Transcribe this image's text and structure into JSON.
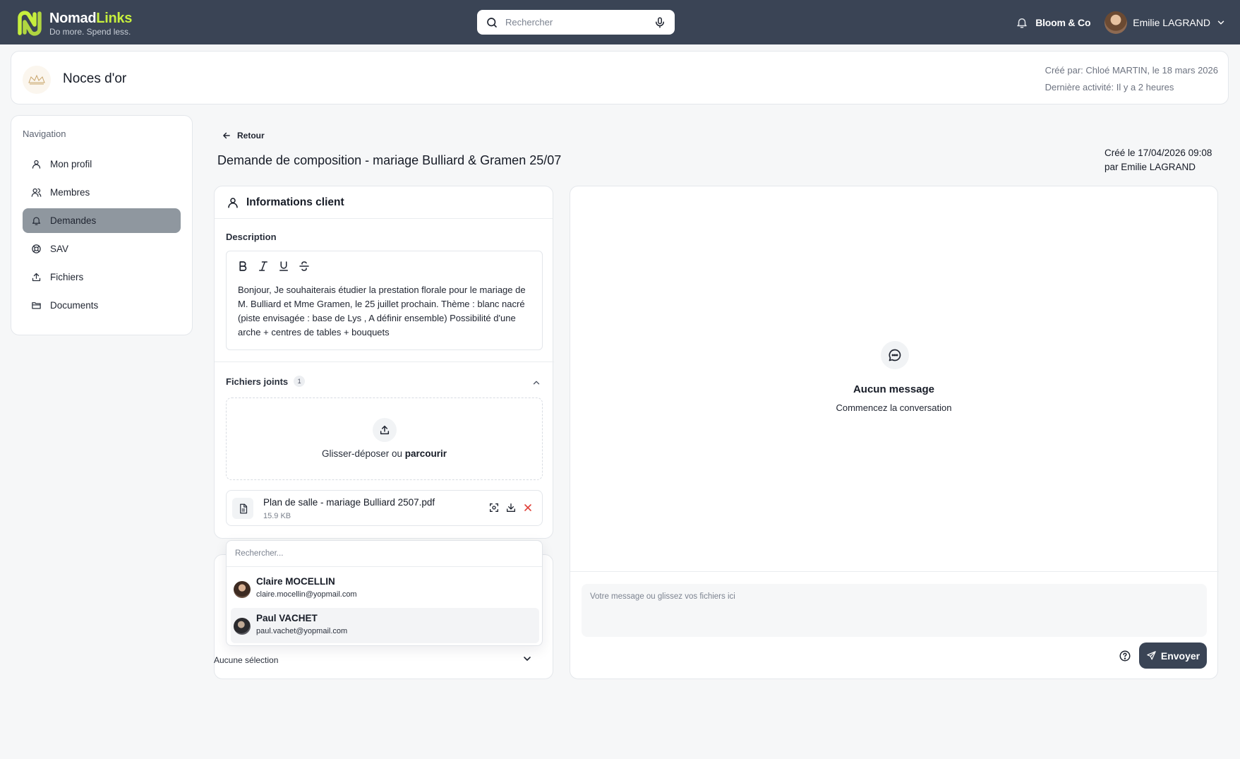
{
  "topbar": {
    "brand_first": "Nomad",
    "brand_second": "Links",
    "tagline": "Do more. Spend less.",
    "search_placeholder": "Rechercher",
    "org_name": "Bloom & Co",
    "user_name": "Emilie LAGRAND",
    "accent_color": "#c6ef3d",
    "bar_color": "#3a4455"
  },
  "header": {
    "logo_text": "Noces d'or",
    "title": "Noces d'or",
    "created_by": "Créé par: Chloé MARTIN, le 18 mars 2026",
    "last_activity": "Dernière activité: Il y a 2 heures"
  },
  "sidebar": {
    "title": "Navigation",
    "items": [
      {
        "label": "Mon profil",
        "icon": "user-icon"
      },
      {
        "label": "Membres",
        "icon": "users-icon"
      },
      {
        "label": "Demandes",
        "icon": "bell-icon",
        "active": true
      },
      {
        "label": "SAV",
        "icon": "lifebuoy-icon"
      },
      {
        "label": "Fichiers",
        "icon": "upload-icon"
      },
      {
        "label": "Documents",
        "icon": "folder-icon"
      }
    ]
  },
  "main": {
    "back_label": "Retour",
    "page_title": "Demande de composition - mariage Bulliard & Gramen 25/07",
    "created_line1": "Créé le 17/04/2026 09:08",
    "created_line2": "par Emilie LAGRAND"
  },
  "client_card": {
    "title": "Informations client",
    "description_label": "Description",
    "description_text": "Bonjour, Je souhaiterais étudier la prestation florale pour le mariage de M. Bulliard et Mme Gramen, le 25 juillet prochain. Thème : blanc nacré (piste envisagée : base de Lys , A définir ensemble) Possibilité d'une arche + centres de tables + bouquets",
    "files_label": "Fichiers joints",
    "files_count": "1",
    "dropzone_text": "Glisser-déposer ou ",
    "dropzone_link": "parcourir",
    "file": {
      "name": "Plan de salle - mariage Bulliard 2507.pdf",
      "size": "15.9 KB"
    }
  },
  "assign": {
    "dropdown_search_placeholder": "Rechercher...",
    "options": [
      {
        "name": "Claire MOCELLIN",
        "email": "claire.mocellin@yopmail.com"
      },
      {
        "name": "Paul VACHET",
        "email": "paul.vachet@yopmail.com"
      }
    ],
    "selected_value": "Aucune sélection"
  },
  "chat": {
    "empty_title": "Aucun message",
    "empty_subtitle": "Commencez la conversation",
    "input_placeholder": "Votre message ou glissez vos fichiers ici",
    "send_label": "Envoyer"
  }
}
